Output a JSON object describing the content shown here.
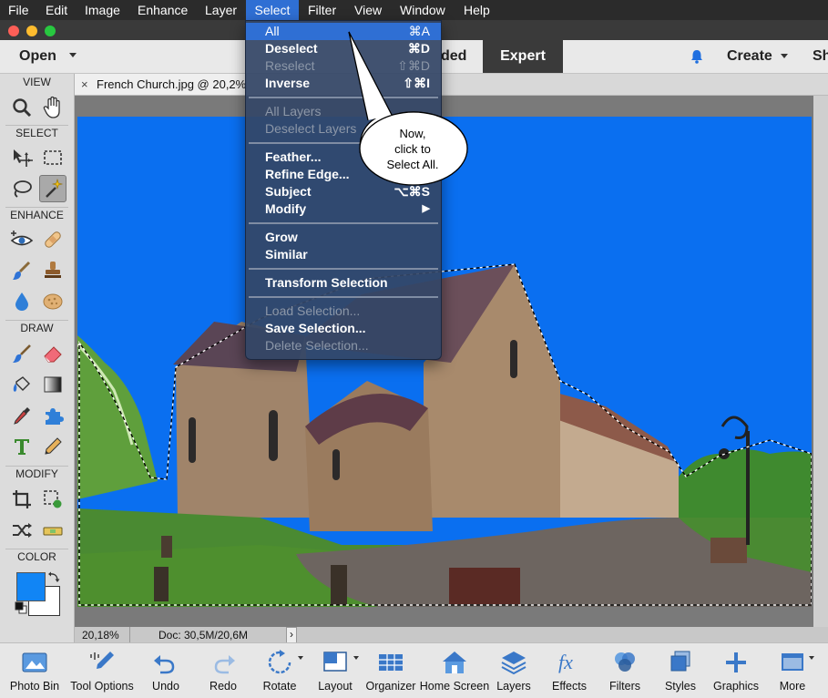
{
  "menubar": {
    "items": [
      "File",
      "Edit",
      "Image",
      "Enhance",
      "Layer",
      "Select",
      "Filter",
      "View",
      "Window",
      "Help"
    ],
    "active": "Select"
  },
  "header": {
    "open_label": "Open",
    "mode_partial": "ded",
    "mode_expert": "Expert",
    "create_label": "Create",
    "share_partial": "Sh"
  },
  "doc_tab": {
    "close": "×",
    "title": "French Church.jpg @ 20,2% ("
  },
  "toolbox": {
    "sections": [
      "VIEW",
      "SELECT",
      "ENHANCE",
      "DRAW",
      "MODIFY",
      "COLOR"
    ]
  },
  "status": {
    "zoom": "20,18%",
    "doc": "Doc: 30,5M/20,6M",
    "arrow": "›"
  },
  "bottom_bar": [
    {
      "label": "Photo Bin",
      "icon": "photo-bin-icon"
    },
    {
      "label": "Tool Options",
      "icon": "tool-options-icon"
    },
    {
      "label": "Undo",
      "icon": "undo-icon"
    },
    {
      "label": "Redo",
      "icon": "redo-icon"
    },
    {
      "label": "Rotate",
      "icon": "rotate-icon"
    },
    {
      "label": "Layout",
      "icon": "layout-icon"
    },
    {
      "label": "Organizer",
      "icon": "organizer-icon"
    },
    {
      "label": "Home Screen",
      "icon": "home-screen-icon"
    },
    {
      "label": "Layers",
      "icon": "layers-icon"
    },
    {
      "label": "Effects",
      "icon": "effects-icon"
    },
    {
      "label": "Filters",
      "icon": "filters-icon"
    },
    {
      "label": "Styles",
      "icon": "styles-icon"
    },
    {
      "label": "Graphics",
      "icon": "graphics-icon"
    },
    {
      "label": "More",
      "icon": "more-icon"
    }
  ],
  "select_menu": {
    "all": {
      "label": "All",
      "shortcut": "⌘A"
    },
    "deselect": {
      "label": "Deselect",
      "shortcut": "⌘D"
    },
    "reselect": {
      "label": "Reselect",
      "shortcut": "⇧⌘D"
    },
    "inverse": {
      "label": "Inverse",
      "shortcut": "⇧⌘I"
    },
    "all_layers": {
      "label": "All Layers"
    },
    "deselect_layers": {
      "label": "Deselect Layers"
    },
    "feather": {
      "label": "Feather..."
    },
    "refine_edge": {
      "label": "Refine Edge..."
    },
    "subject": {
      "label": "Subject",
      "shortcut": "⌥⌘S"
    },
    "modify": {
      "label": "Modify",
      "shortcut": "▶"
    },
    "grow": {
      "label": "Grow"
    },
    "similar": {
      "label": "Similar"
    },
    "transform_selection": {
      "label": "Transform Selection"
    },
    "load_selection": {
      "label": "Load Selection..."
    },
    "save_selection": {
      "label": "Save Selection..."
    },
    "delete_selection": {
      "label": "Delete Selection..."
    }
  },
  "callout": {
    "line1": "Now,",
    "line2": "click to",
    "line3": "Select All."
  },
  "colors": {
    "sky": "#0a6ff0",
    "foreground": "#1185f5",
    "menu_highlight": "#2f6fd4"
  }
}
